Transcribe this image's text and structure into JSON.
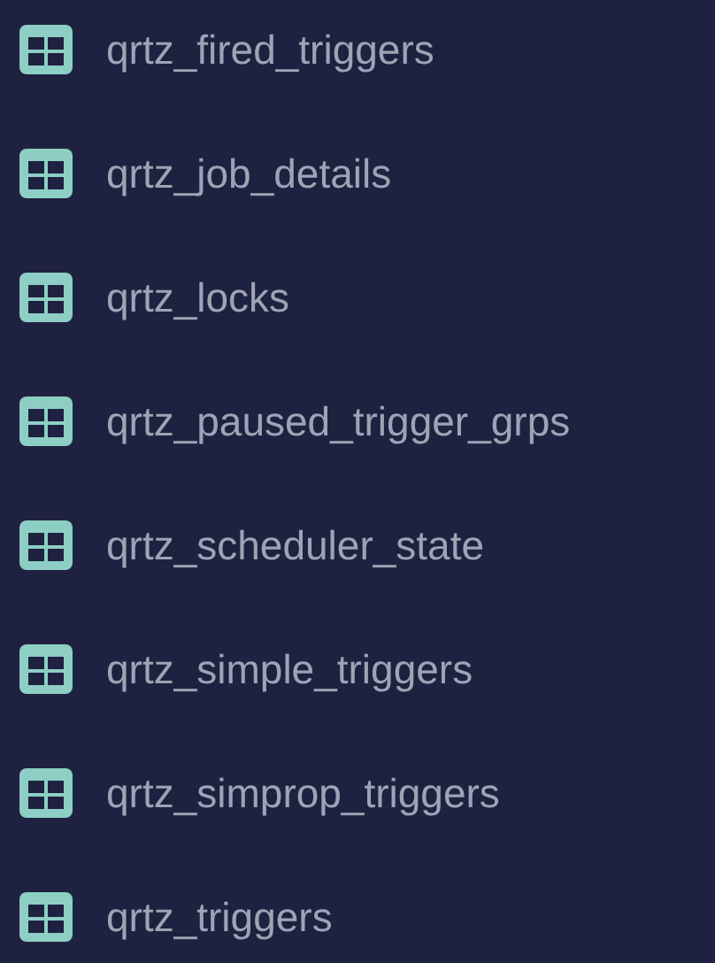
{
  "tables": [
    {
      "name": "qrtz_fired_triggers"
    },
    {
      "name": "qrtz_job_details"
    },
    {
      "name": "qrtz_locks"
    },
    {
      "name": "qrtz_paused_trigger_grps"
    },
    {
      "name": "qrtz_scheduler_state"
    },
    {
      "name": "qrtz_simple_triggers"
    },
    {
      "name": "qrtz_simprop_triggers"
    },
    {
      "name": "qrtz_triggers"
    }
  ]
}
